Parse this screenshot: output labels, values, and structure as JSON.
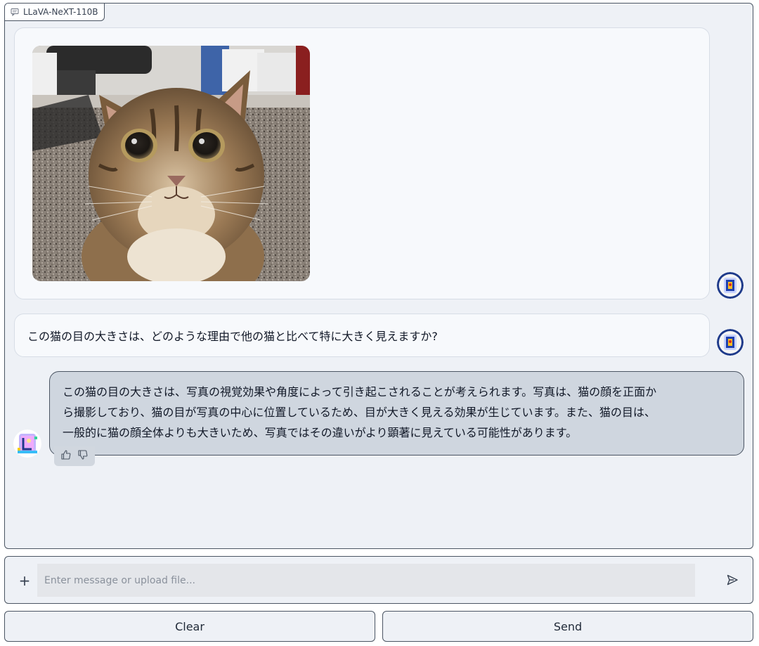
{
  "model": {
    "label": "LLaVA-NeXT-110B",
    "icon": "chat-bubble-icon"
  },
  "chat": {
    "user_image_alt": "cat photo",
    "user_question": "この猫の目の大きさは、どのような理由で他の猫と比べて特に大きく見えますか?",
    "bot_answer_lines": [
      "この猫の目の大きさは、写真の視覚効果や角度によって引き起こされることが考えられます。写真は、猫の顔を正面か",
      "ら撮影しており、猫の目が写真の中心に位置しているため、目が大きく見える効果が生じています。また、猫の目は、",
      "一般的に猫の顔全体よりも大きいため、写真ではその違いがより顕著に見えている可能性があります。"
    ],
    "feedback": {
      "like_icon": "thumbs-up-icon",
      "dislike_icon": "thumbs-down-icon"
    }
  },
  "input": {
    "plus_label": "+",
    "placeholder": "Enter message or upload file...",
    "value": "",
    "send_icon": "send-arrow-icon"
  },
  "buttons": {
    "clear": "Clear",
    "send": "Send"
  },
  "colors": {
    "panel_bg": "#eef1f6",
    "bubble_bg": "#f7f9fc",
    "bot_bubble_bg": "#cfd6df",
    "border": "#4b5563"
  }
}
